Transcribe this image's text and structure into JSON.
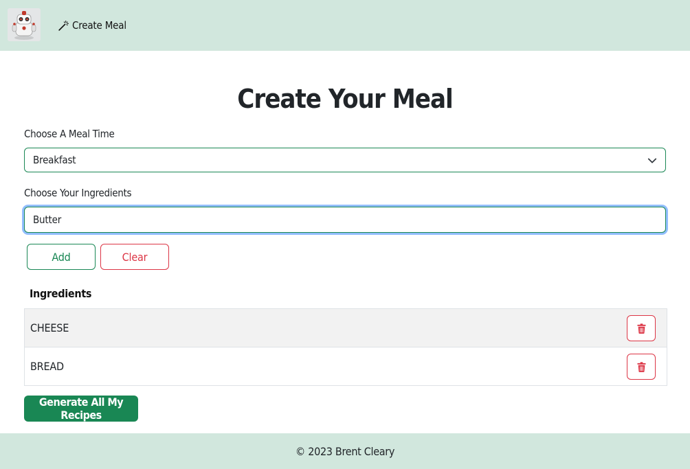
{
  "navbar": {
    "logo_icon": "robot-icon",
    "create_meal_link": "Create Meal",
    "create_meal_icon": "magic-wand-icon",
    "background": "#d1e7dd"
  },
  "page": {
    "title": "Create Your Meal"
  },
  "meal_time": {
    "label": "Choose A Meal Time",
    "selected": "Breakfast"
  },
  "ingredients_input": {
    "label": "Choose Your Ingredients",
    "value": "Butter"
  },
  "buttons": {
    "add": "Add",
    "clear": "Clear",
    "generate": "Generate All My Recipes"
  },
  "ingredients_list": {
    "title": "Ingredients",
    "items": [
      {
        "name": "CHEESE"
      },
      {
        "name": "BREAD"
      }
    ],
    "delete_icon": "trash-icon"
  },
  "footer": {
    "text": "© 2023 Brent Cleary"
  },
  "colors": {
    "success": "#198754",
    "danger": "#dc3545",
    "focus_ring": "#0d6efd"
  }
}
